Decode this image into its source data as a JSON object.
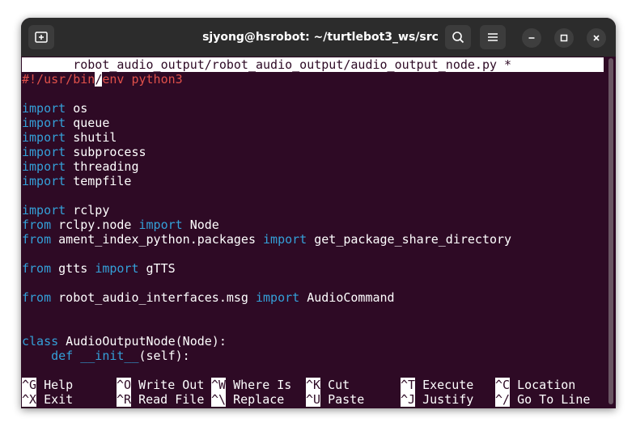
{
  "window": {
    "title": "sjyong@hsrobot: ~/turtlebot3_ws/src",
    "new_tab_icon": "new-tab-icon",
    "search_icon": "search-icon",
    "menu_icon": "hamburger-menu-icon",
    "minimize_icon": "minimize-icon",
    "maximize_icon": "maximize-icon",
    "close_icon": "close-icon"
  },
  "editor": {
    "header": "       robot_audio_output/robot_audio_output/audio_output_node.py *",
    "shebang_before_cursor": "#!/usr/bin",
    "cursor_char": "/",
    "shebang_after_cursor": "env python3",
    "lines": {
      "l3": {
        "kw": "import",
        "rest": " os"
      },
      "l4": {
        "kw": "import",
        "rest": " queue"
      },
      "l5": {
        "kw": "import",
        "rest": " shutil"
      },
      "l6": {
        "kw": "import",
        "rest": " subprocess"
      },
      "l7": {
        "kw": "import",
        "rest": " threading"
      },
      "l8": {
        "kw": "import",
        "rest": " tempfile"
      },
      "l10": {
        "kw": "import",
        "rest": " rclpy"
      },
      "l11": {
        "kw1": "from",
        "mid": " rclpy.node ",
        "kw2": "import",
        "rest": " Node"
      },
      "l12": {
        "kw1": "from",
        "mid": " ament_index_python.packages ",
        "kw2": "import",
        "rest": " get_package_share_directory"
      },
      "l14": {
        "kw1": "from",
        "mid": " gtts ",
        "kw2": "import",
        "rest": " gTTS"
      },
      "l16": {
        "kw1": "from",
        "mid": " robot_audio_interfaces.msg ",
        "kw2": "import",
        "rest": " AudioCommand"
      },
      "l19": {
        "kw": "class",
        "rest": " AudioOutputNode(Node):"
      },
      "l20": {
        "indent": "    ",
        "kw1": "def",
        "sp": " ",
        "kw2": "__init__",
        "rest": "(self):"
      }
    }
  },
  "shortcuts": [
    {
      "key": "^G",
      "label": " Help"
    },
    {
      "key": "^O",
      "label": " Write Out"
    },
    {
      "key": "^W",
      "label": " Where Is"
    },
    {
      "key": "^K",
      "label": " Cut"
    },
    {
      "key": "^T",
      "label": " Execute"
    },
    {
      "key": "^C",
      "label": " Location"
    },
    {
      "key": "^X",
      "label": " Exit"
    },
    {
      "key": "^R",
      "label": " Read File"
    },
    {
      "key": "^\\",
      "label": " Replace"
    },
    {
      "key": "^U",
      "label": " Paste"
    },
    {
      "key": "^J",
      "label": " Justify"
    },
    {
      "key": "^/",
      "label": " Go To Line"
    }
  ],
  "colors": {
    "terminal_bg": "#2e0a25",
    "keyword": "#34a0d8",
    "shebang": "#e0504a",
    "titlebar": "#2c2c2c"
  }
}
